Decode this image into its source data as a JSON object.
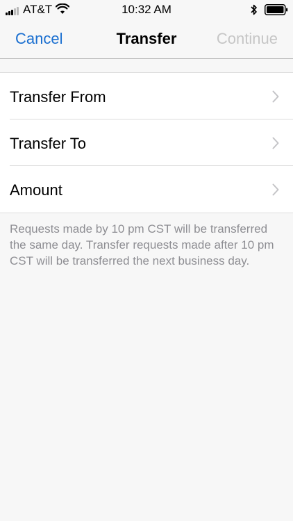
{
  "status_bar": {
    "carrier": "AT&T",
    "time": "10:32 AM",
    "icons": [
      "signal-icon",
      "wifi-icon",
      "bluetooth-icon",
      "battery-icon"
    ]
  },
  "nav": {
    "left_label": "Cancel",
    "title": "Transfer",
    "right_label": "Continue"
  },
  "rows": [
    {
      "label": "Transfer From",
      "icon": "chevron-right-icon"
    },
    {
      "label": "Transfer To",
      "icon": "chevron-right-icon"
    },
    {
      "label": "Amount",
      "icon": "chevron-right-icon"
    }
  ],
  "footer": {
    "text": "Requests made by 10 pm CST will be transferred the same day. Transfer requests made after 10 pm CST will be transferred the next business day."
  },
  "colors": {
    "accent": "#1a6fd0",
    "disabled": "#c6c6c6",
    "secondary_text": "#8e8e93",
    "background": "#f7f7f7"
  }
}
